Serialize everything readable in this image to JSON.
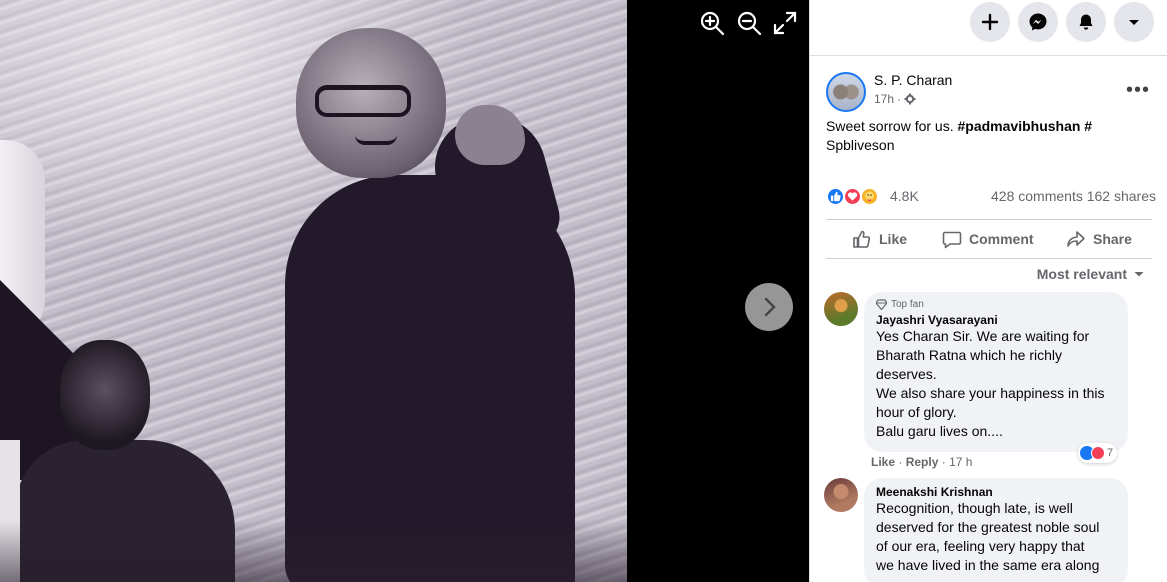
{
  "viewer": {
    "controls": [
      "zoom-in-icon",
      "zoom-out-icon",
      "fullscreen-icon"
    ],
    "next_icon": "chevron-right-icon"
  },
  "topbar": {
    "buttons": [
      "plus-icon",
      "messenger-icon",
      "bell-icon",
      "caret-down-icon"
    ]
  },
  "post": {
    "author": "S. P. Charan",
    "time": "17h",
    "privacy_icon": "gear-icon",
    "more": "•••",
    "text_plain": "Sweet sorrow for us. ",
    "hashtag1": "#padmavibhushan",
    "text_mid": " #",
    "text_line2": "Spbliveson",
    "reactions": {
      "icons": [
        "like",
        "love",
        "care"
      ],
      "count": "4.8K",
      "comments_shares": "428 comments  162 shares"
    },
    "actions": {
      "like": "Like",
      "comment": "Comment",
      "share": "Share"
    },
    "sort_label": "Most relevant"
  },
  "comments": [
    {
      "badge": "Top fan",
      "name": "Jayashri Vyasarayani",
      "lines": [
        "Yes Charan Sir. We are waiting for",
        "Bharath Ratna which he richly",
        "deserves.",
        "We also share your happiness in this",
        "hour of glory.",
        "Balu garu lives on...."
      ],
      "like": "Like",
      "reply": "Reply",
      "time": "17 h",
      "reaction_count": "7"
    },
    {
      "name": "Meenakshi Krishnan",
      "lines": [
        "Recognition, though late, is well",
        "deserved for the greatest noble soul",
        "of our era, feeling very happy that",
        "we have lived in the same era along"
      ]
    }
  ],
  "colors": {
    "accent": "#1877f2",
    "love": "#f33e58",
    "care": "#f7b125",
    "muted": "#65676b"
  }
}
